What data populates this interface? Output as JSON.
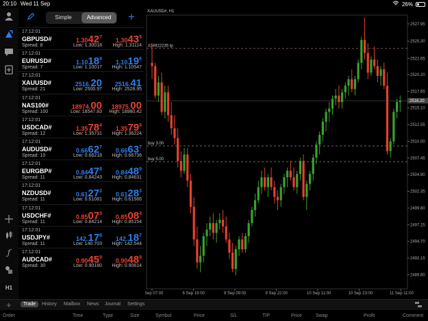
{
  "status": {
    "time": "20:10",
    "date": "Wed 11 Sep",
    "battery": "26%"
  },
  "quotes_header": {
    "simple": "Simple",
    "advanced": "Advanced"
  },
  "quotes": [
    {
      "time": "17:12:01",
      "symbol": "GBPUSD#",
      "spread": "Spread: 8",
      "dir": "down",
      "bid": {
        "s": "1.30",
        "b": "42",
        "p": "7"
      },
      "ask": {
        "s": "1.30",
        "b": "43",
        "p": "5"
      },
      "low": "Low: 1.30018",
      "high": "High: 1.31114"
    },
    {
      "time": "17:12:01",
      "symbol": "EURUSD#",
      "spread": "Spread: 7",
      "dir": "up",
      "bid": {
        "s": "1.10",
        "b": "18",
        "p": "9"
      },
      "ask": {
        "s": "1.10",
        "b": "19",
        "p": "6"
      },
      "low": "Low: 1.10017",
      "high": "High: 1.10547"
    },
    {
      "time": "17:12:01",
      "symbol": "XAUUSD#",
      "spread": "Spread: 21",
      "dir": "up",
      "bid": {
        "s": "2516.",
        "b": "20",
        "p": ""
      },
      "ask": {
        "s": "2516.",
        "b": "41",
        "p": ""
      },
      "low": "Low: 2500.97",
      "high": "High: 2528.95"
    },
    {
      "time": "17:12:01",
      "symbol": "NAS100#",
      "spread": "Spread: 100",
      "dir": "down",
      "bid": {
        "s": "18974.",
        "b": "00",
        "p": ""
      },
      "ask": {
        "s": "18975.",
        "b": "00",
        "p": ""
      },
      "low": "Low: 18547.83",
      "high": "High: 18980.42"
    },
    {
      "time": "17:12:01",
      "symbol": "USDCAD#",
      "spread": "Spread: 12",
      "dir": "down",
      "bid": {
        "s": "1.35",
        "b": "78",
        "p": "4"
      },
      "ask": {
        "s": "1.35",
        "b": "79",
        "p": "6"
      },
      "low": "Low: 1.35731",
      "high": "High: 1.36224"
    },
    {
      "time": "17:12:01",
      "symbol": "AUDUSD#",
      "spread": "Spread: 10",
      "dir": "up",
      "bid": {
        "s": "0.66",
        "b": "62",
        "p": "7"
      },
      "ask": {
        "s": "0.66",
        "b": "63",
        "p": "7"
      },
      "low": "Low: 0.66218",
      "high": "High: 0.66736"
    },
    {
      "time": "17:12:01",
      "symbol": "EURGBP#",
      "spread": "Spread: 11",
      "dir": "up",
      "bid": {
        "s": "0.84",
        "b": "47",
        "p": "8"
      },
      "ask": {
        "s": "0.84",
        "b": "48",
        "p": "9"
      },
      "low": "Low: 0.84243",
      "high": "High: 0.84631"
    },
    {
      "time": "17:12:01",
      "symbol": "NZDUSD#",
      "spread": "Spread: 11",
      "dir": "up",
      "bid": {
        "s": "0.61",
        "b": "27",
        "p": "2"
      },
      "ask": {
        "s": "0.61",
        "b": "28",
        "p": "3"
      },
      "low": "Low: 0.61081",
      "high": "High: 0.61566"
    },
    {
      "time": "17:12:01",
      "symbol": "USDCHF#",
      "spread": "Spread: 11",
      "dir": "down",
      "bid": {
        "s": "0.85",
        "b": "07",
        "p": "3"
      },
      "ask": {
        "s": "0.85",
        "b": "08",
        "p": "4"
      },
      "low": "Low: 0.84214",
      "high": "High: 0.85154"
    },
    {
      "time": "17:12:01",
      "symbol": "USDJPY#",
      "spread": "Spread: 11",
      "dir": "up",
      "bid": {
        "s": "142.",
        "b": "17",
        "p": "6"
      },
      "ask": {
        "s": "142.",
        "b": "18",
        "p": "7"
      },
      "low": "Low: 140.703",
      "high": "High: 142.544"
    },
    {
      "time": "17:12:01",
      "symbol": "AUDCAD#",
      "spread": "Spread: 30",
      "dir": "down",
      "bid": {
        "s": "0.90",
        "b": "45",
        "p": "9"
      },
      "ask": {
        "s": "0.90",
        "b": "48",
        "p": "9"
      },
      "low": "Low: 0.90180",
      "high": "High: 0.90614"
    }
  ],
  "chart_title": "XAUUSD#, H1",
  "chart_data": {
    "type": "candlestick",
    "symbol": "XAUUSD#",
    "timeframe": "H1",
    "ylim": [
      2487.45,
      2529.3
    ],
    "y_ticks": [
      "2527.95",
      "2525.30",
      "2522.65",
      "2520.20",
      "2517.65",
      "2515.10",
      "2512.55",
      "2510.00",
      "2507.45",
      "2504.90",
      "2502.35",
      "2499.80",
      "2497.25",
      "2494.70",
      "2492.15",
      "2489.60"
    ],
    "x_ticks": [
      "6 Sep 07:00",
      "6 Sep 19:00",
      "9 Sep 09:00",
      "9 Sep 22:00",
      "10 Sep 11:00",
      "10 Sep 23:00",
      "11 Sep 11:00"
    ],
    "current_price_label": "2516.20",
    "levels": [
      {
        "label": "#24922235 tp",
        "price": 2524.2,
        "color": "#9a6a6a"
      },
      {
        "label": "buy 3.00",
        "price": 2509.3,
        "color": "#8f8f8f"
      },
      {
        "label": "buy 5.00",
        "price": 2506.9,
        "color": "#8f8f8f"
      }
    ],
    "candles": [
      [
        2522.0,
        2525.0,
        2519.5,
        2521.5
      ],
      [
        2521.5,
        2522.0,
        2516.5,
        2517.0
      ],
      [
        2517.0,
        2520.0,
        2516.0,
        2519.0
      ],
      [
        2519.0,
        2520.5,
        2514.0,
        2514.5
      ],
      [
        2514.5,
        2518.5,
        2513.5,
        2517.5
      ],
      [
        2517.5,
        2518.5,
        2513.0,
        2514.0
      ],
      [
        2514.0,
        2516.0,
        2511.0,
        2512.0
      ],
      [
        2512.0,
        2514.0,
        2509.5,
        2510.5
      ],
      [
        2510.5,
        2512.0,
        2506.0,
        2507.0
      ],
      [
        2507.0,
        2508.5,
        2504.5,
        2505.5
      ],
      [
        2505.5,
        2509.0,
        2505.0,
        2508.0
      ],
      [
        2508.0,
        2509.0,
        2503.0,
        2504.0
      ],
      [
        2504.0,
        2505.0,
        2499.0,
        2500.0
      ],
      [
        2500.0,
        2501.5,
        2494.0,
        2495.0
      ],
      [
        2495.0,
        2497.0,
        2490.5,
        2491.5
      ],
      [
        2491.5,
        2494.0,
        2490.0,
        2492.5
      ],
      [
        2492.5,
        2496.0,
        2491.5,
        2495.5
      ],
      [
        2495.5,
        2497.5,
        2494.0,
        2496.5
      ],
      [
        2496.5,
        2498.5,
        2495.5,
        2497.5
      ],
      [
        2497.5,
        2499.0,
        2495.0,
        2496.0
      ],
      [
        2496.0,
        2498.0,
        2494.5,
        2497.5
      ],
      [
        2497.5,
        2499.0,
        2496.5,
        2498.0
      ],
      [
        2498.0,
        2499.5,
        2496.0,
        2497.0
      ],
      [
        2497.0,
        2498.5,
        2494.5,
        2495.0
      ],
      [
        2495.0,
        2496.0,
        2492.0,
        2493.0
      ],
      [
        2493.0,
        2494.5,
        2490.0,
        2490.5
      ],
      [
        2490.5,
        2494.0,
        2489.5,
        2493.5
      ],
      [
        2493.5,
        2495.5,
        2492.5,
        2495.0
      ],
      [
        2495.0,
        2496.0,
        2493.0,
        2493.5
      ],
      [
        2493.5,
        2496.0,
        2493.0,
        2495.5
      ],
      [
        2495.5,
        2498.0,
        2494.5,
        2497.5
      ],
      [
        2497.5,
        2500.0,
        2497.0,
        2499.5
      ],
      [
        2499.5,
        2502.0,
        2498.5,
        2501.0
      ],
      [
        2501.0,
        2504.0,
        2500.5,
        2503.0
      ],
      [
        2503.0,
        2505.5,
        2502.0,
        2504.5
      ],
      [
        2504.5,
        2506.0,
        2502.5,
        2503.0
      ],
      [
        2503.0,
        2505.0,
        2501.5,
        2504.5
      ],
      [
        2504.5,
        2506.0,
        2502.5,
        2503.0
      ],
      [
        2503.0,
        2504.0,
        2500.5,
        2501.5
      ],
      [
        2501.5,
        2502.5,
        2499.5,
        2501.0
      ],
      [
        2501.0,
        2503.5,
        2500.0,
        2503.0
      ],
      [
        2503.0,
        2505.0,
        2502.0,
        2504.5
      ],
      [
        2504.5,
        2506.0,
        2503.0,
        2505.5
      ],
      [
        2505.5,
        2507.0,
        2504.0,
        2504.5
      ],
      [
        2504.5,
        2506.0,
        2502.5,
        2503.0
      ],
      [
        2503.0,
        2505.5,
        2502.0,
        2505.0
      ],
      [
        2505.0,
        2507.5,
        2504.0,
        2507.0
      ],
      [
        2507.0,
        2508.0,
        2501.0,
        2501.5
      ],
      [
        2501.5,
        2504.0,
        2499.5,
        2503.5
      ],
      [
        2503.5,
        2505.5,
        2502.5,
        2505.0
      ],
      [
        2505.0,
        2508.0,
        2504.0,
        2507.5
      ],
      [
        2507.5,
        2510.0,
        2506.5,
        2509.5
      ],
      [
        2509.5,
        2511.5,
        2508.0,
        2511.0
      ],
      [
        2511.0,
        2513.5,
        2510.0,
        2513.0
      ],
      [
        2513.0,
        2515.0,
        2511.5,
        2514.5
      ],
      [
        2514.5,
        2516.0,
        2513.0,
        2515.0
      ],
      [
        2515.0,
        2517.0,
        2514.0,
        2516.5
      ],
      [
        2516.5,
        2518.0,
        2515.5,
        2517.0
      ],
      [
        2517.0,
        2518.5,
        2515.0,
        2516.0
      ],
      [
        2516.0,
        2518.0,
        2515.0,
        2517.5
      ],
      [
        2517.5,
        2519.0,
        2516.5,
        2518.5
      ],
      [
        2518.5,
        2520.0,
        2517.0,
        2519.5
      ],
      [
        2519.5,
        2521.0,
        2517.5,
        2518.0
      ],
      [
        2518.0,
        2520.0,
        2517.0,
        2519.5
      ],
      [
        2519.5,
        2522.5,
        2519.0,
        2522.0
      ],
      [
        2522.0,
        2526.0,
        2521.0,
        2525.5
      ],
      [
        2525.5,
        2528.9,
        2522.5,
        2523.5
      ],
      [
        2523.5,
        2525.0,
        2519.5,
        2520.5
      ],
      [
        2520.5,
        2523.0,
        2520.0,
        2522.5
      ],
      [
        2522.5,
        2524.5,
        2521.0,
        2521.5
      ],
      [
        2521.5,
        2522.5,
        2519.0,
        2520.0
      ],
      [
        2520.0,
        2521.5,
        2518.5,
        2521.0
      ],
      [
        2521.0,
        2522.0,
        2518.0,
        2518.5
      ],
      [
        2518.5,
        2520.5,
        2508.0,
        2508.5
      ],
      [
        2508.5,
        2510.5,
        2507.5,
        2510.0
      ],
      [
        2510.0,
        2515.0,
        2509.5,
        2514.5
      ],
      [
        2514.5,
        2516.5,
        2513.5,
        2516.0
      ],
      [
        2516.0,
        2517.0,
        2514.5,
        2516.2
      ]
    ]
  },
  "tabs": [
    "Trade",
    "History",
    "Mailbox",
    "News",
    "Journal",
    "Settings"
  ],
  "columns": [
    "Order",
    "Time",
    "Type",
    "Size",
    "Symbol",
    "Price",
    "S/L",
    "T/P",
    "Price",
    "Swap",
    "Profit",
    "Comment"
  ],
  "colors": {
    "up": "#3aa12f",
    "down": "#e5412f",
    "accent": "#2b7de9"
  }
}
